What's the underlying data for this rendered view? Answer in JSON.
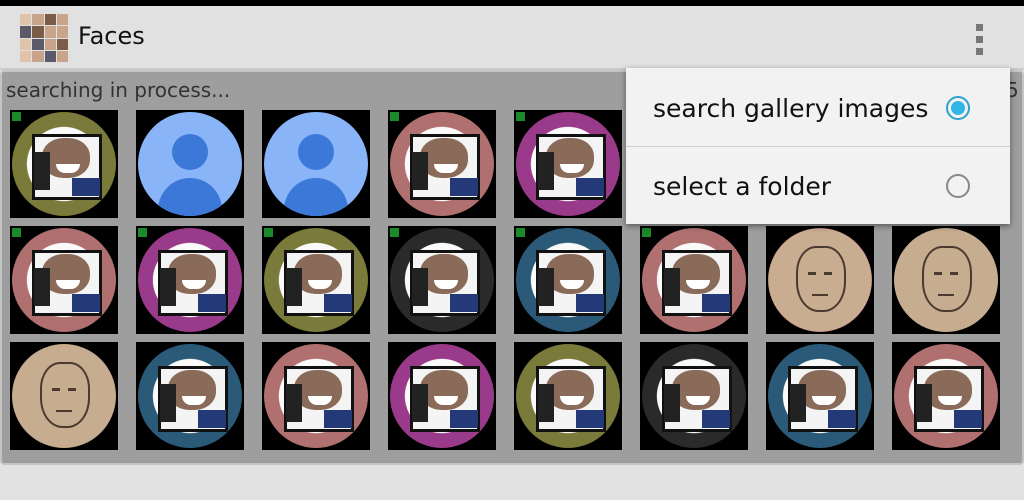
{
  "actionbar": {
    "title": "Faces",
    "app_icon": "faces-collage-icon",
    "overflow_icon": "overflow-menu-icon"
  },
  "status": {
    "text": "searching in process...",
    "count_fragment": "5"
  },
  "menu": {
    "items": [
      {
        "label": "search gallery images",
        "checked": true
      },
      {
        "label": "select a folder",
        "checked": false
      }
    ]
  },
  "grid": {
    "rows": [
      [
        {
          "kind": "photo",
          "marked": true
        },
        {
          "kind": "avatar",
          "marked": false
        },
        {
          "kind": "avatar",
          "marked": false
        },
        {
          "kind": "photo",
          "marked": true
        },
        {
          "kind": "photo",
          "marked": true
        }
      ],
      [
        {
          "kind": "photo",
          "marked": true
        },
        {
          "kind": "photo",
          "marked": true
        },
        {
          "kind": "photo",
          "marked": true
        },
        {
          "kind": "photo",
          "marked": true
        },
        {
          "kind": "photo",
          "marked": true
        },
        {
          "kind": "photo",
          "marked": true
        },
        {
          "kind": "sketch",
          "marked": false
        },
        {
          "kind": "sketch",
          "marked": false
        }
      ],
      [
        {
          "kind": "sketch",
          "marked": false
        },
        {
          "kind": "photo",
          "marked": false
        },
        {
          "kind": "photo",
          "marked": false
        },
        {
          "kind": "photo",
          "marked": false
        },
        {
          "kind": "photo",
          "marked": false
        },
        {
          "kind": "photo",
          "marked": false
        },
        {
          "kind": "photo",
          "marked": false
        },
        {
          "kind": "photo",
          "marked": false
        }
      ]
    ]
  },
  "colors": {
    "accent": "#33b5e5",
    "marker": "#1a8a2a"
  }
}
